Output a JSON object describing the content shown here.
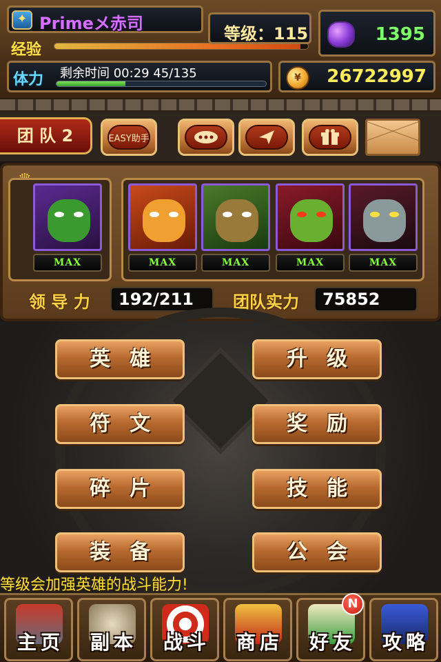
{
  "player": {
    "name": "Primeメ赤司",
    "level_text": "等级：115",
    "exp_label": "经验",
    "exp_progress": 0.97
  },
  "stamina": {
    "label": "体力",
    "timer_text": "剩余时间   00:29    45/135",
    "progress": 0.33
  },
  "currency": {
    "gems": "1395",
    "gold": "26722997"
  },
  "toolbar": {
    "team_tab": "团 队 2",
    "easy_helper": "EASY助手",
    "chat_icon": "chat-icon",
    "send_icon": "send-icon",
    "gift_icon": "gift-icon",
    "mail_icon": "mail-icon"
  },
  "team": {
    "max_label": "MAX",
    "leadership_label": "领 导 力",
    "leadership_value": "192/211",
    "power_label": "团队实力",
    "power_value": "75852",
    "heroes": [
      {
        "name": "leader-orc-hero"
      },
      {
        "name": "hero-orange-brute"
      },
      {
        "name": "hero-tree-ent"
      },
      {
        "name": "hero-red-demon"
      },
      {
        "name": "hero-ghost-woman"
      }
    ]
  },
  "menu": {
    "heroes": "英雄",
    "upgrade": "升级",
    "runes": "符文",
    "rewards": "奖励",
    "fragments": "碎片",
    "skills": "技能",
    "equipment": "装备",
    "guild": "公会"
  },
  "tip": "等级会加强英雄的战斗能力!",
  "nav": {
    "home": "主页",
    "dungeon": "副本",
    "battle": "战斗",
    "shop": "商店",
    "friends": "好友",
    "guide": "攻略",
    "new_badge": "N"
  },
  "colors": {
    "gold_text": "#ffec5a",
    "gem_text": "#7dff6a",
    "name_purple": "#d470ff",
    "max_green": "#8aff40",
    "stamina_green": "#3aa02a"
  }
}
